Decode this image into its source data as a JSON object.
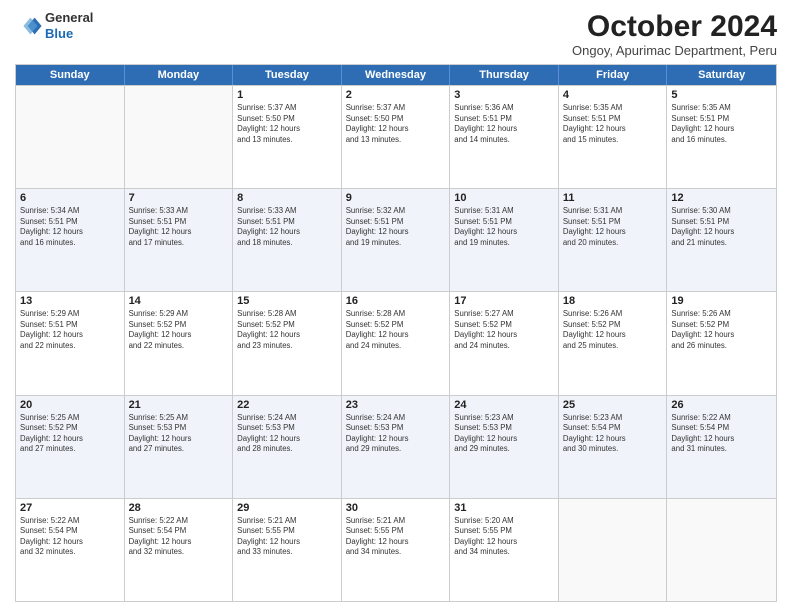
{
  "header": {
    "logo_line1": "General",
    "logo_line2": "Blue",
    "month": "October 2024",
    "location": "Ongoy, Apurimac Department, Peru"
  },
  "days_of_week": [
    "Sunday",
    "Monday",
    "Tuesday",
    "Wednesday",
    "Thursday",
    "Friday",
    "Saturday"
  ],
  "weeks": [
    [
      {
        "day": "",
        "info": ""
      },
      {
        "day": "",
        "info": ""
      },
      {
        "day": "1",
        "info": "Sunrise: 5:37 AM\nSunset: 5:50 PM\nDaylight: 12 hours\nand 13 minutes."
      },
      {
        "day": "2",
        "info": "Sunrise: 5:37 AM\nSunset: 5:50 PM\nDaylight: 12 hours\nand 13 minutes."
      },
      {
        "day": "3",
        "info": "Sunrise: 5:36 AM\nSunset: 5:51 PM\nDaylight: 12 hours\nand 14 minutes."
      },
      {
        "day": "4",
        "info": "Sunrise: 5:35 AM\nSunset: 5:51 PM\nDaylight: 12 hours\nand 15 minutes."
      },
      {
        "day": "5",
        "info": "Sunrise: 5:35 AM\nSunset: 5:51 PM\nDaylight: 12 hours\nand 16 minutes."
      }
    ],
    [
      {
        "day": "6",
        "info": "Sunrise: 5:34 AM\nSunset: 5:51 PM\nDaylight: 12 hours\nand 16 minutes."
      },
      {
        "day": "7",
        "info": "Sunrise: 5:33 AM\nSunset: 5:51 PM\nDaylight: 12 hours\nand 17 minutes."
      },
      {
        "day": "8",
        "info": "Sunrise: 5:33 AM\nSunset: 5:51 PM\nDaylight: 12 hours\nand 18 minutes."
      },
      {
        "day": "9",
        "info": "Sunrise: 5:32 AM\nSunset: 5:51 PM\nDaylight: 12 hours\nand 19 minutes."
      },
      {
        "day": "10",
        "info": "Sunrise: 5:31 AM\nSunset: 5:51 PM\nDaylight: 12 hours\nand 19 minutes."
      },
      {
        "day": "11",
        "info": "Sunrise: 5:31 AM\nSunset: 5:51 PM\nDaylight: 12 hours\nand 20 minutes."
      },
      {
        "day": "12",
        "info": "Sunrise: 5:30 AM\nSunset: 5:51 PM\nDaylight: 12 hours\nand 21 minutes."
      }
    ],
    [
      {
        "day": "13",
        "info": "Sunrise: 5:29 AM\nSunset: 5:51 PM\nDaylight: 12 hours\nand 22 minutes."
      },
      {
        "day": "14",
        "info": "Sunrise: 5:29 AM\nSunset: 5:52 PM\nDaylight: 12 hours\nand 22 minutes."
      },
      {
        "day": "15",
        "info": "Sunrise: 5:28 AM\nSunset: 5:52 PM\nDaylight: 12 hours\nand 23 minutes."
      },
      {
        "day": "16",
        "info": "Sunrise: 5:28 AM\nSunset: 5:52 PM\nDaylight: 12 hours\nand 24 minutes."
      },
      {
        "day": "17",
        "info": "Sunrise: 5:27 AM\nSunset: 5:52 PM\nDaylight: 12 hours\nand 24 minutes."
      },
      {
        "day": "18",
        "info": "Sunrise: 5:26 AM\nSunset: 5:52 PM\nDaylight: 12 hours\nand 25 minutes."
      },
      {
        "day": "19",
        "info": "Sunrise: 5:26 AM\nSunset: 5:52 PM\nDaylight: 12 hours\nand 26 minutes."
      }
    ],
    [
      {
        "day": "20",
        "info": "Sunrise: 5:25 AM\nSunset: 5:52 PM\nDaylight: 12 hours\nand 27 minutes."
      },
      {
        "day": "21",
        "info": "Sunrise: 5:25 AM\nSunset: 5:53 PM\nDaylight: 12 hours\nand 27 minutes."
      },
      {
        "day": "22",
        "info": "Sunrise: 5:24 AM\nSunset: 5:53 PM\nDaylight: 12 hours\nand 28 minutes."
      },
      {
        "day": "23",
        "info": "Sunrise: 5:24 AM\nSunset: 5:53 PM\nDaylight: 12 hours\nand 29 minutes."
      },
      {
        "day": "24",
        "info": "Sunrise: 5:23 AM\nSunset: 5:53 PM\nDaylight: 12 hours\nand 29 minutes."
      },
      {
        "day": "25",
        "info": "Sunrise: 5:23 AM\nSunset: 5:54 PM\nDaylight: 12 hours\nand 30 minutes."
      },
      {
        "day": "26",
        "info": "Sunrise: 5:22 AM\nSunset: 5:54 PM\nDaylight: 12 hours\nand 31 minutes."
      }
    ],
    [
      {
        "day": "27",
        "info": "Sunrise: 5:22 AM\nSunset: 5:54 PM\nDaylight: 12 hours\nand 32 minutes."
      },
      {
        "day": "28",
        "info": "Sunrise: 5:22 AM\nSunset: 5:54 PM\nDaylight: 12 hours\nand 32 minutes."
      },
      {
        "day": "29",
        "info": "Sunrise: 5:21 AM\nSunset: 5:55 PM\nDaylight: 12 hours\nand 33 minutes."
      },
      {
        "day": "30",
        "info": "Sunrise: 5:21 AM\nSunset: 5:55 PM\nDaylight: 12 hours\nand 34 minutes."
      },
      {
        "day": "31",
        "info": "Sunrise: 5:20 AM\nSunset: 5:55 PM\nDaylight: 12 hours\nand 34 minutes."
      },
      {
        "day": "",
        "info": ""
      },
      {
        "day": "",
        "info": ""
      }
    ]
  ]
}
